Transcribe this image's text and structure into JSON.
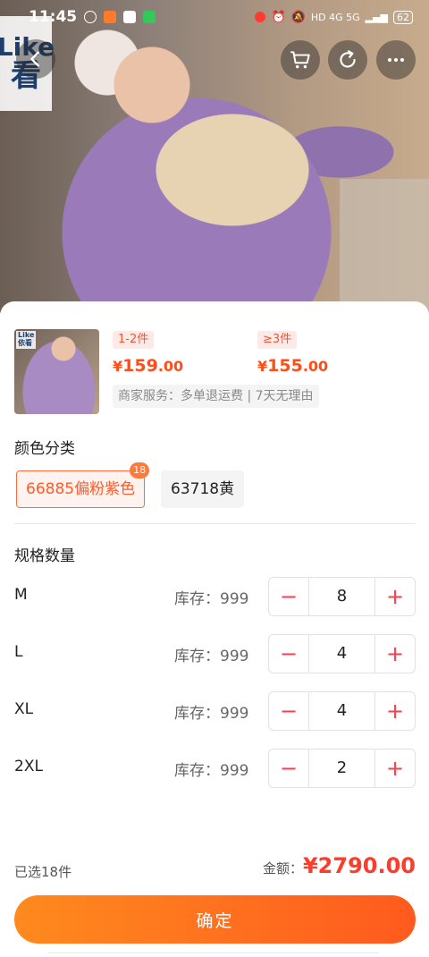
{
  "status_bar": {
    "time": "11:45",
    "network": "HD 4G 5G",
    "battery": "62"
  },
  "watermark": {
    "line1": "Like",
    "line2": "看"
  },
  "product": {
    "thumb_watermark": "Like\n依看",
    "price_tiers": [
      {
        "range": "1-2件",
        "currency": "¥",
        "integer": "159",
        "decimal": ".00"
      },
      {
        "range": "≥3件",
        "currency": "¥",
        "integer": "155",
        "decimal": ".00"
      }
    ],
    "service": "商家服务：多单退运费 | 7天无理由"
  },
  "color_section": {
    "title": "颜色分类",
    "options": [
      {
        "label": "66885偏粉紫色",
        "badge": "18",
        "selected": true
      },
      {
        "label": "63718黄",
        "selected": false
      }
    ]
  },
  "size_section": {
    "title": "规格数量",
    "rows": [
      {
        "size": "M",
        "stock": "库存：999",
        "qty": "8"
      },
      {
        "size": "L",
        "stock": "库存：999",
        "qty": "4"
      },
      {
        "size": "XL",
        "stock": "库存：999",
        "qty": "4"
      },
      {
        "size": "2XL",
        "stock": "库存：999",
        "qty": "2"
      }
    ],
    "minus": "−",
    "plus": "+"
  },
  "summary": {
    "selected_count": "已选18件",
    "amount_label": "金额：",
    "amount": "¥2790.00"
  },
  "confirm_label": "确定",
  "colors": {
    "accent": "#ff5a1e",
    "price": "#ff4d1a",
    "stepper": "#ff3b4e"
  }
}
